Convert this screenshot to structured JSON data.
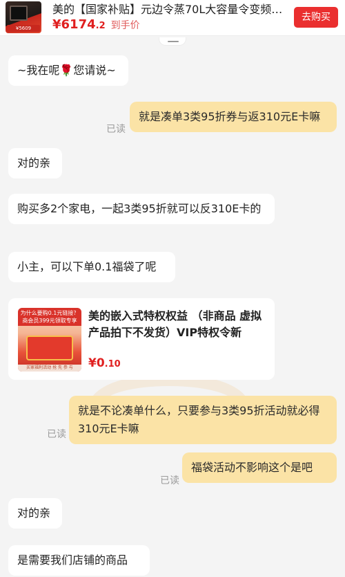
{
  "product": {
    "title": "美的【国家补贴】元边令蒸70L大容量令变频…",
    "price_main": "¥6174",
    "price_decimal": ".2",
    "price_note": "到手价",
    "buy_label": "去购买",
    "thumb_tag": "¥5609"
  },
  "messages": [
    {
      "side": "left",
      "text": "~我在呢🌹您请说~"
    },
    {
      "side": "right",
      "text": "就是凑单3类95折券与返310元E卡嘛",
      "read": "已读"
    },
    {
      "side": "left",
      "text": "对的亲"
    },
    {
      "side": "left",
      "text": "购买多2个家电，一起3类95折就可以反310E卡的"
    },
    {
      "side": "left",
      "text": "小主，可以下单0.1福袋了呢"
    },
    {
      "side": "right",
      "text": "就是不论凑单什么，只要参与3类95折活动就必得310元E卡嘛",
      "read": "已读"
    },
    {
      "side": "right",
      "text": "福袋活动不影响这个是吧",
      "read": "已读"
    },
    {
      "side": "left",
      "text": "对的亲"
    },
    {
      "side": "left",
      "text": "是需要我们店铺的商品"
    }
  ],
  "card": {
    "title": "美的嵌入式特权权益 （非商品 虚拟产品拍下不发货）VIP特权令新",
    "price_main": "¥0",
    "price_decimal": ".10",
    "img_banner": "为什么要购0.1元链接？ 商会员399元领取专享",
    "img_foot": "买家福利活动 抢 先 参 与"
  }
}
